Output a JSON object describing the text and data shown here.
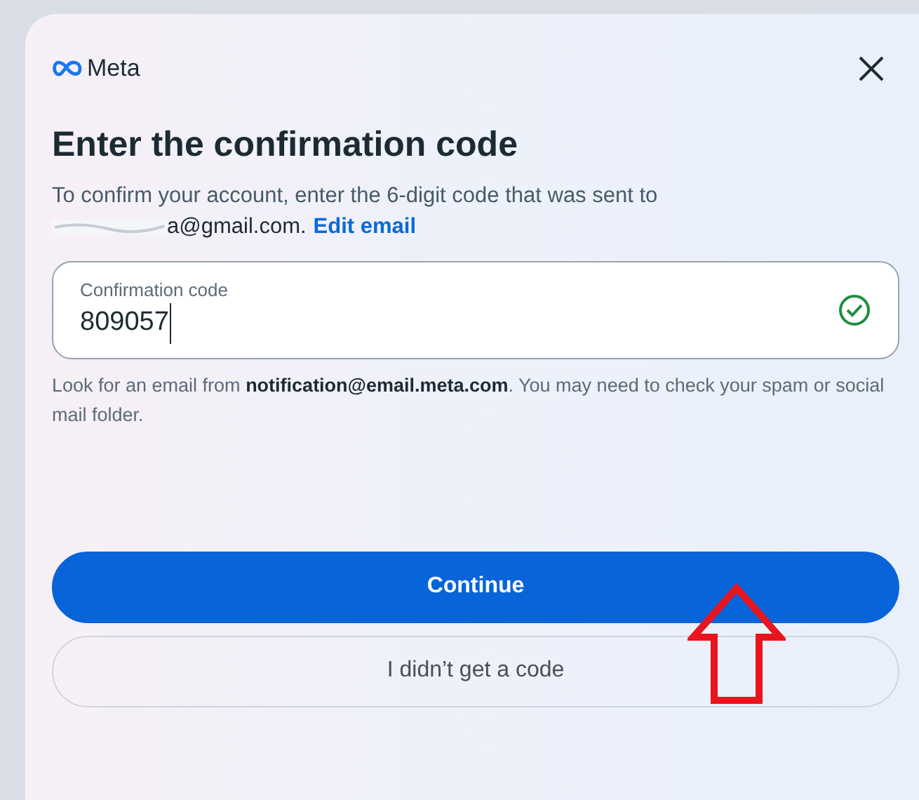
{
  "brand": {
    "name": "Meta"
  },
  "title": "Enter the confirmation code",
  "description": {
    "text": "To confirm your account, enter the 6-digit code that was sent to",
    "email": "a@gmail.com.",
    "link": "Edit email"
  },
  "code_field": {
    "label": "Confirmation code",
    "value": "809057",
    "valid": true
  },
  "hint": "Look for an email from **notification@email.meta.com**. You may need to check your spam or social mail folder.",
  "buttons": [
    {
      "kind": "primary",
      "label": "Continue"
    },
    {
      "kind": "secondary",
      "label": "I didn’t get a code"
    }
  ]
}
